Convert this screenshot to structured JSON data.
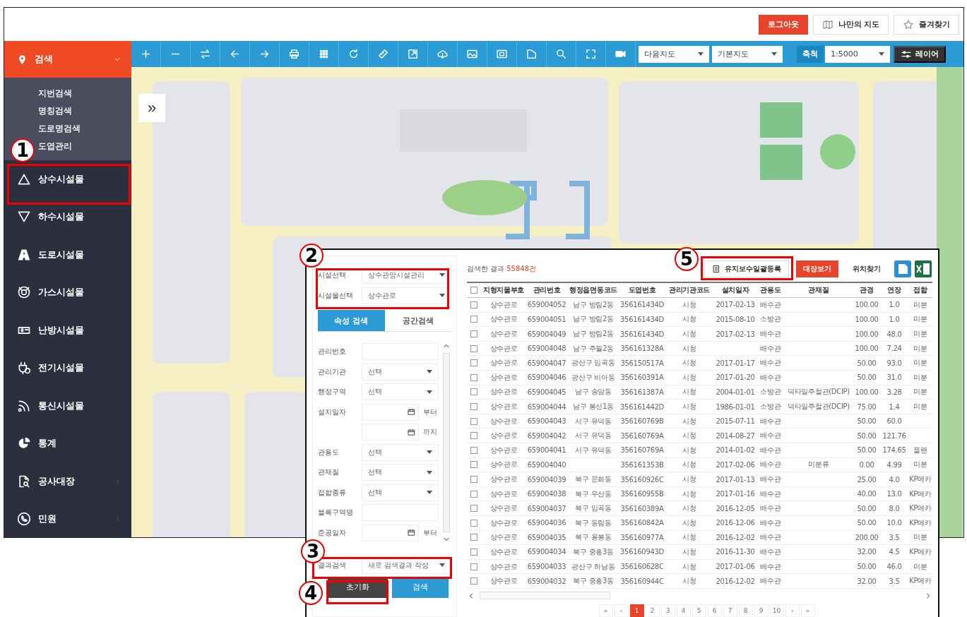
{
  "top_bar": {
    "buttons": [
      {
        "label": "로그아웃",
        "kind": "primary"
      },
      {
        "label": "나만의 지도",
        "kind": "map"
      },
      {
        "label": "즐겨찾기",
        "kind": "star"
      }
    ]
  },
  "sidebar": {
    "header": {
      "label": "검색",
      "expanded": true
    },
    "submenu": [
      "지번검색",
      "명칭검색",
      "도로명검색",
      "도엽관리"
    ],
    "items": [
      {
        "label": "상수시설물",
        "arrow": false
      },
      {
        "label": "하수시설물",
        "arrow": false
      },
      {
        "label": "도로시설물",
        "arrow": false
      },
      {
        "label": "가스시설물",
        "arrow": false
      },
      {
        "label": "난방시설물",
        "arrow": false
      },
      {
        "label": "전기시설물",
        "arrow": false
      },
      {
        "label": "통신시설물",
        "arrow": false
      },
      {
        "label": "통계",
        "arrow": false
      },
      {
        "label": "공사대장",
        "arrow": true
      },
      {
        "label": "민원",
        "arrow": true
      }
    ]
  },
  "toolbar": {
    "map_selects": [
      "다음지도",
      "기본지도"
    ],
    "scale_label": "축척",
    "scale_value": "1:5000",
    "layer_button": "레이어"
  },
  "map": {
    "collapse_button": "»"
  },
  "search_panel": {
    "selects": [
      {
        "label": "시설선택",
        "value": "상수관망시설관리"
      },
      {
        "label": "시설물선택",
        "value": "상수관로"
      }
    ],
    "tabs": [
      {
        "label": "속성 검색",
        "selected": true
      },
      {
        "label": "공간검색",
        "selected": false
      }
    ],
    "fields": [
      {
        "kind": "input",
        "label": "관리번호"
      },
      {
        "kind": "select",
        "label": "관리기관",
        "value": "선택"
      },
      {
        "kind": "select",
        "label": "행정구역",
        "value": "선택"
      },
      {
        "kind": "date",
        "label": "설치일자",
        "suffix": "부터"
      },
      {
        "kind": "date",
        "suffix": "까지"
      },
      {
        "kind": "select",
        "label": "관용도",
        "value": "선택"
      },
      {
        "kind": "select",
        "label": "관재질",
        "value": "선택"
      },
      {
        "kind": "select",
        "label": "접합종류",
        "value": "선택"
      },
      {
        "kind": "input",
        "label": "블록구역명"
      },
      {
        "kind": "date",
        "label": "준공일자",
        "suffix": "부터"
      }
    ],
    "result_search": {
      "label": "결과검색",
      "value": "새로 검색결과 작성"
    },
    "buttons": [
      {
        "label": "초기화",
        "kind": "reset"
      },
      {
        "label": "검색",
        "kind": "search"
      }
    ]
  },
  "results": {
    "summary": "검색한 결과",
    "count": "55848건",
    "actions": [
      {
        "label": "유지보수일괄등록",
        "kind": "outline"
      },
      {
        "label": "대장보기",
        "kind": "primary"
      },
      {
        "label": "위치찾기",
        "kind": "plain"
      }
    ],
    "columns": [
      "지형지물부호",
      "관리번호",
      "행정읍면동코드",
      "도엽번호",
      "관리기관코드",
      "설치일자",
      "관용도",
      "관재질",
      "관경",
      "연장",
      "접합"
    ],
    "header_checked": false,
    "rows": [
      {
        "checked": false,
        "cells": [
          "상수관로",
          "659004052",
          "남구 방림2동",
          "356161434D",
          "시청",
          "2017-02-13",
          "배수관",
          "",
          "100.00",
          "1.0",
          "미분"
        ]
      },
      {
        "checked": false,
        "cells": [
          "상수관로",
          "659004051",
          "남구 방림2동",
          "356161434D",
          "시청",
          "2015-08-10",
          "소방관",
          "",
          "100.00",
          "1.0",
          "미분"
        ]
      },
      {
        "checked": false,
        "cells": [
          "상수관로",
          "659004049",
          "남구 방림2동",
          "356161434D",
          "시청",
          "2017-02-13",
          "배수관",
          "",
          "100.00",
          "48.0",
          "미분"
        ]
      },
      {
        "checked": false,
        "cells": [
          "상수관로",
          "659004048",
          "남구 주월2동",
          "356161328A",
          "시청",
          "",
          "배수관",
          "",
          "100.00",
          "7.24",
          "미분"
        ]
      },
      {
        "checked": false,
        "cells": [
          "상수관로",
          "659004047",
          "광산구 임곡동",
          "356150517A",
          "시청",
          "2017-01-17",
          "배수관",
          "",
          "50.00",
          "93.0",
          "미분"
        ]
      },
      {
        "checked": false,
        "cells": [
          "상수관로",
          "659004046",
          "광산구 비아동",
          "356160391A",
          "시청",
          "2017-01-20",
          "배수관",
          "",
          "50.00",
          "31.0",
          "미분"
        ]
      },
      {
        "checked": false,
        "cells": [
          "상수관로",
          "659004045",
          "남구 송암동",
          "356161387A",
          "시청",
          "2004-01-01",
          "소방관",
          "덕타일주철관(DCIP)",
          "100.00",
          "3.28",
          "미분"
        ]
      },
      {
        "checked": false,
        "cells": [
          "상수관로",
          "659004044",
          "남구 봉선1동",
          "356161442D",
          "시청",
          "1986-01-01",
          "소방관",
          "덕타일주철관(DCIP)",
          "75.00",
          "1.4",
          "미분"
        ]
      },
      {
        "checked": false,
        "cells": [
          "상수관로",
          "659004043",
          "서구 유덕동",
          "356160769B",
          "시청",
          "2015-07-11",
          "배수관",
          "",
          "50.00",
          "60.0",
          ""
        ]
      },
      {
        "checked": false,
        "cells": [
          "상수관로",
          "659004042",
          "서구 유덕동",
          "356160769A",
          "시청",
          "2014-08-27",
          "배수관",
          "",
          "50.00",
          "121.76",
          ""
        ]
      },
      {
        "checked": false,
        "cells": [
          "상수관로",
          "659004041",
          "서구 유덕동",
          "356160769A",
          "시청",
          "2014-01-02",
          "배수관",
          "",
          "50.00",
          "174.65",
          "플랜"
        ]
      },
      {
        "checked": false,
        "cells": [
          "상수관로",
          "659004040",
          "",
          "356161353B",
          "시청",
          "2017-02-06",
          "배수관",
          "미분류",
          "0.00",
          "4.99",
          "미분"
        ]
      },
      {
        "checked": false,
        "cells": [
          "상수관로",
          "659004039",
          "북구 문화동",
          "356160926C",
          "시청",
          "2017-01-13",
          "배수관",
          "",
          "25.00",
          "4.0",
          "KP메카"
        ]
      },
      {
        "checked": false,
        "cells": [
          "상수관로",
          "659004038",
          "북구 우산동",
          "356160955B",
          "시청",
          "2017-01-16",
          "배수관",
          "",
          "40.00",
          "13.0",
          "KP메카"
        ]
      },
      {
        "checked": false,
        "cells": [
          "상수관로",
          "659004037",
          "북구 임곡동",
          "356160389A",
          "시청",
          "2016-12-05",
          "배수관",
          "",
          "50.00",
          "8.0",
          "KP메카"
        ]
      },
      {
        "checked": false,
        "cells": [
          "상수관로",
          "659004036",
          "북구 동림동",
          "356160842A",
          "시청",
          "2016-12-06",
          "배수관",
          "",
          "50.00",
          "10.0",
          "KP메카"
        ]
      },
      {
        "checked": false,
        "cells": [
          "상수관로",
          "659004035",
          "북구 용봉동",
          "356160977A",
          "시청",
          "2016-12-02",
          "배수관",
          "",
          "200.00",
          "3.5",
          "미분"
        ]
      },
      {
        "checked": false,
        "cells": [
          "상수관로",
          "659004034",
          "북구 중흥3동",
          "356160943D",
          "시청",
          "2016-11-30",
          "배수관",
          "",
          "32.00",
          "4.5",
          "KP메카"
        ]
      },
      {
        "checked": false,
        "cells": [
          "상수관로",
          "659004033",
          "광산구 하남동",
          "356160628C",
          "시청",
          "2017-01-06",
          "배수관",
          "",
          "50.00",
          "46.0",
          "미분"
        ]
      },
      {
        "checked": false,
        "cells": [
          "상수관로",
          "659004032",
          "북구 중흥3동",
          "356160944C",
          "시청",
          "2016-12-02",
          "배수관",
          "",
          "32.00",
          "3.5",
          "KP메카"
        ]
      }
    ],
    "pagination": {
      "first": "«",
      "prev": "‹",
      "next": "›",
      "last": "»",
      "pages": [
        {
          "label": "1",
          "selected": true
        },
        {
          "label": "2",
          "selected": false
        },
        {
          "label": "3",
          "selected": false
        },
        {
          "label": "4",
          "selected": false
        },
        {
          "label": "5",
          "selected": false
        },
        {
          "label": "6",
          "selected": false
        },
        {
          "label": "7",
          "selected": false
        },
        {
          "label": "8",
          "selected": false
        },
        {
          "label": "9",
          "selected": false
        },
        {
          "label": "10",
          "selected": false
        }
      ]
    }
  },
  "annotations": [
    {
      "number": "1"
    },
    {
      "number": "2"
    },
    {
      "number": "3"
    },
    {
      "number": "4"
    },
    {
      "number": "5"
    }
  ]
}
